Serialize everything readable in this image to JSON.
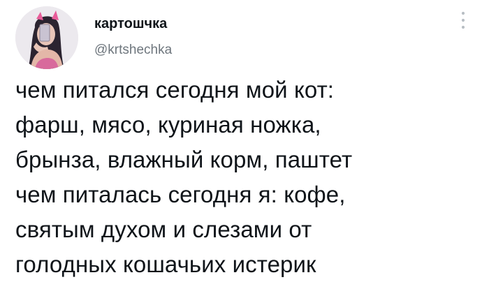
{
  "author": {
    "display_name": "картошчка",
    "handle": "@krtshechka"
  },
  "more_menu": {
    "icon": "more-vertical-icon"
  },
  "tweet": {
    "lines": [
      "чем питался сегодня мой кот:",
      "фарш, мясо, куриная ножка,",
      "брынза, влажный корм, паштет",
      "чем питалась сегодня я: кофе,",
      "святым духом и слезами от",
      "голодных кошачьих истерик"
    ]
  },
  "colors": {
    "text": "#0f1419",
    "secondary_text": "#6e767d",
    "background": "#ffffff",
    "avatar_accent": "#e85d9a"
  }
}
